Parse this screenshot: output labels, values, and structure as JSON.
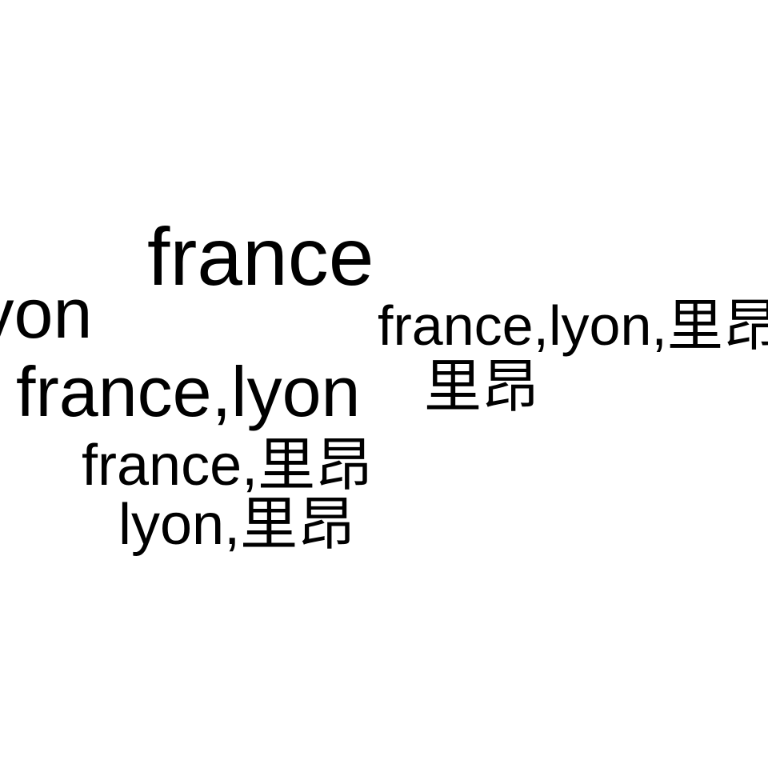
{
  "words": {
    "france": "france",
    "lyon": "lyon",
    "france_lyon_zh": "france,lyon,里昂",
    "france_lyon": "france,lyon",
    "zh": "里昂",
    "france_zh": "france,里昂",
    "lyon_zh": "lyon,里昂"
  },
  "colors": {
    "background": "#ffffff",
    "text": "#000000"
  }
}
